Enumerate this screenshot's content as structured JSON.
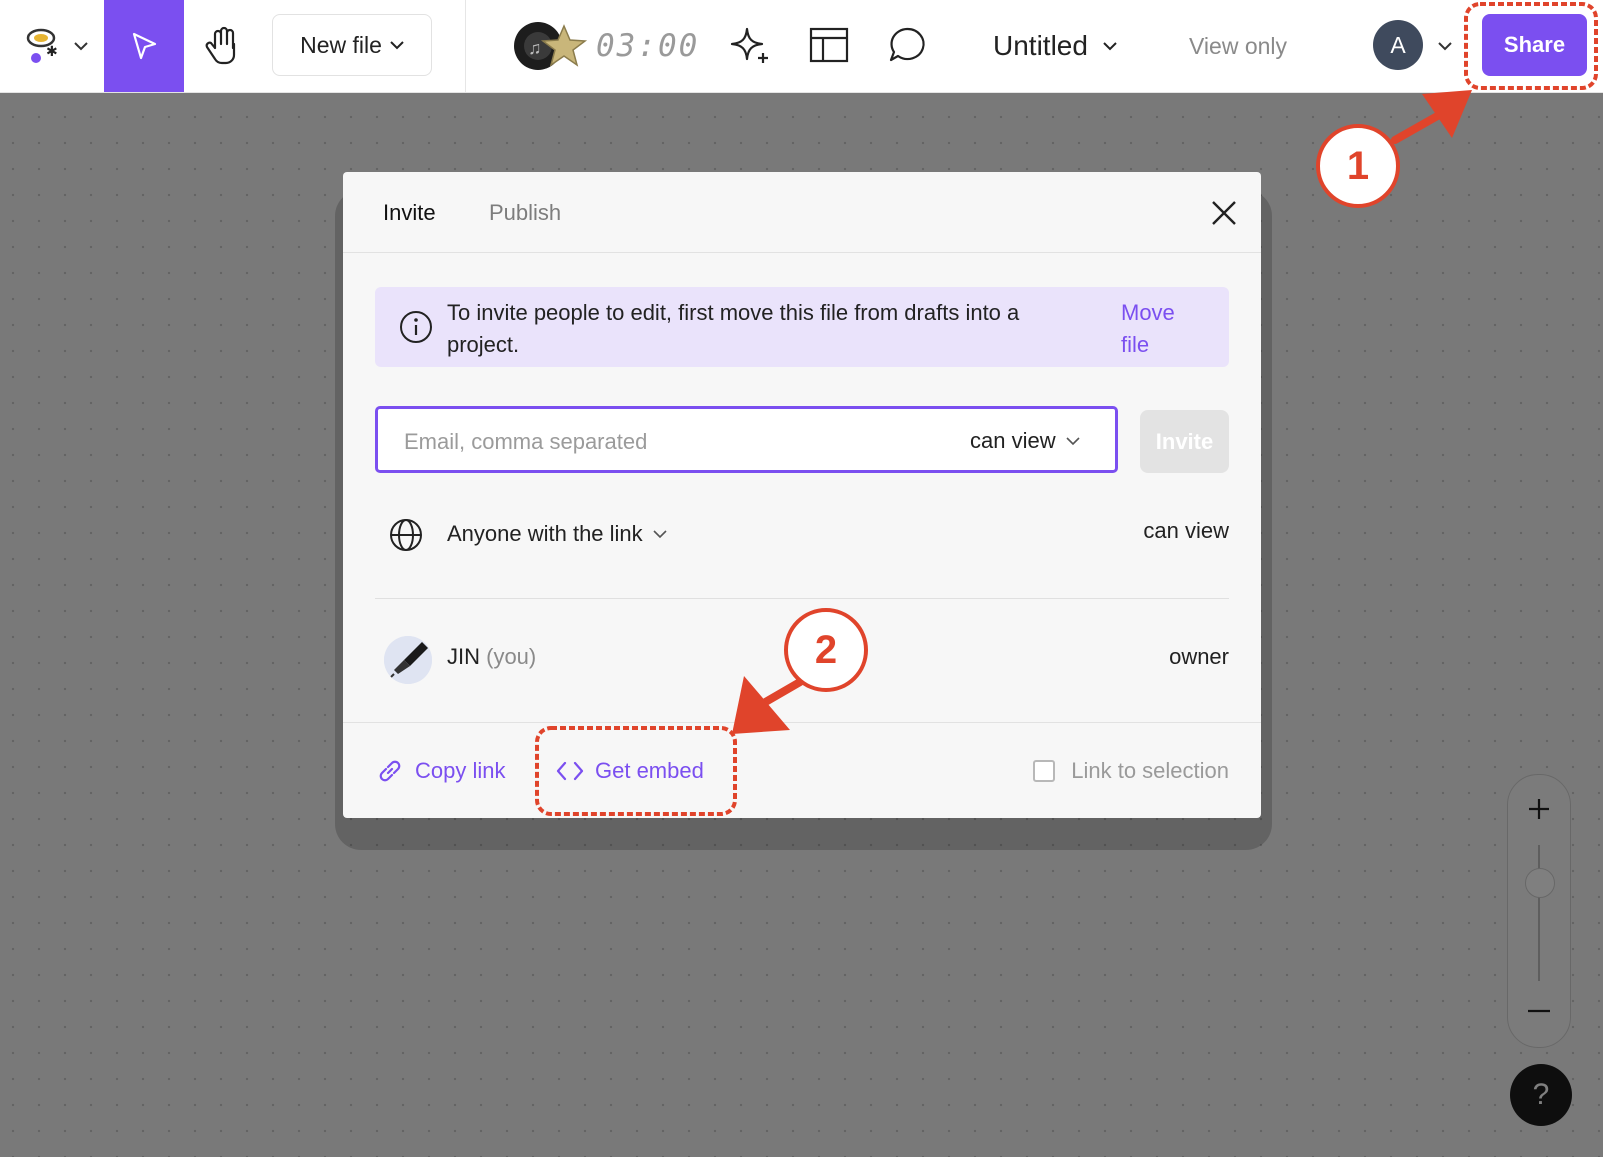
{
  "toolbar": {
    "new_file_label": "New file",
    "timer_text": "03:00",
    "file_title": "Untitled",
    "view_only_label": "View only",
    "avatar_initial": "A",
    "share_label": "Share",
    "accent_color": "#7b4ff0"
  },
  "dialog": {
    "tabs": [
      {
        "label": "Invite",
        "active": true
      },
      {
        "label": "Publish",
        "active": false
      }
    ],
    "banner": {
      "text": "To invite people to edit, first move this file from drafts into a project.",
      "link_label": "Move file"
    },
    "email": {
      "value": "",
      "placeholder": "Email, comma separated",
      "permission": "can view"
    },
    "invite_button_label": "Invite",
    "link_access": {
      "scope_label": "Anyone with the link",
      "permission": "can view"
    },
    "members": [
      {
        "name": "JIN",
        "suffix": "(you)",
        "role": "owner"
      }
    ],
    "footer": {
      "copy_link_label": "Copy link",
      "get_embed_label": "Get embed",
      "link_to_selection_label": "Link to selection",
      "link_to_selection_checked": false
    }
  },
  "zoom": {
    "help_label": "?"
  },
  "annotations": {
    "step_1": "1",
    "step_2": "2",
    "color": "#e0442b"
  }
}
